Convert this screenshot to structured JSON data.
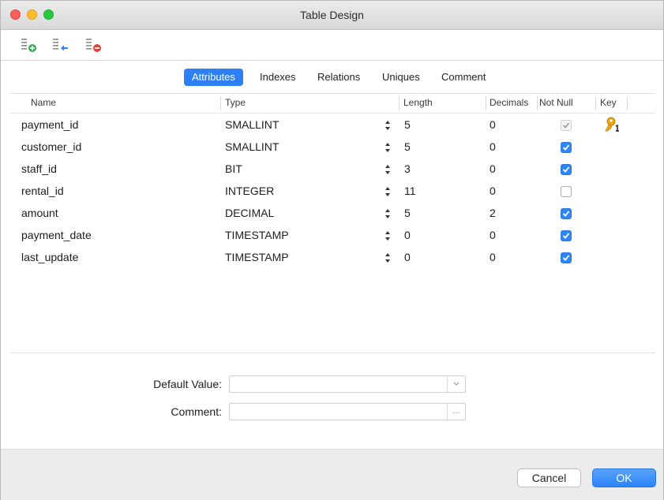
{
  "window": {
    "title": "Table Design"
  },
  "toolbar": {
    "add_icon": "add-field-icon",
    "insert_icon": "insert-field-icon",
    "delete_icon": "delete-field-icon"
  },
  "tabs": [
    {
      "label": "Attributes",
      "active": true
    },
    {
      "label": "Indexes",
      "active": false
    },
    {
      "label": "Relations",
      "active": false
    },
    {
      "label": "Uniques",
      "active": false
    },
    {
      "label": "Comment",
      "active": false
    }
  ],
  "table": {
    "headers": {
      "name": "Name",
      "type": "Type",
      "length": "Length",
      "decimals": "Decimals",
      "not_null": "Not Null",
      "key": "Key"
    },
    "rows": [
      {
        "name": "payment_id",
        "type": "SMALLINT",
        "length": "5",
        "decimals": "0",
        "not_null": "disabled-checked",
        "key": true
      },
      {
        "name": "customer_id",
        "type": "SMALLINT",
        "length": "5",
        "decimals": "0",
        "not_null": "checked",
        "key": false
      },
      {
        "name": "staff_id",
        "type": "BIT",
        "length": "3",
        "decimals": "0",
        "not_null": "checked",
        "key": false
      },
      {
        "name": "rental_id",
        "type": "INTEGER",
        "length": "11",
        "decimals": "0",
        "not_null": "unchecked",
        "key": false
      },
      {
        "name": "amount",
        "type": "DECIMAL",
        "length": "5",
        "decimals": "2",
        "not_null": "checked",
        "key": false
      },
      {
        "name": "payment_date",
        "type": "TIMESTAMP",
        "length": "0",
        "decimals": "0",
        "not_null": "checked",
        "key": false
      },
      {
        "name": "last_update",
        "type": "TIMESTAMP",
        "length": "0",
        "decimals": "0",
        "not_null": "checked",
        "key": false
      }
    ]
  },
  "form": {
    "default_label": "Default Value:",
    "default_value": "",
    "comment_label": "Comment:",
    "comment_value": "",
    "comment_button": "..."
  },
  "buttons": {
    "cancel": "Cancel",
    "ok": "OK"
  },
  "colors": {
    "accent": "#2d7ff5",
    "checkbox": "#2f86f6",
    "key": "#e8a317"
  }
}
